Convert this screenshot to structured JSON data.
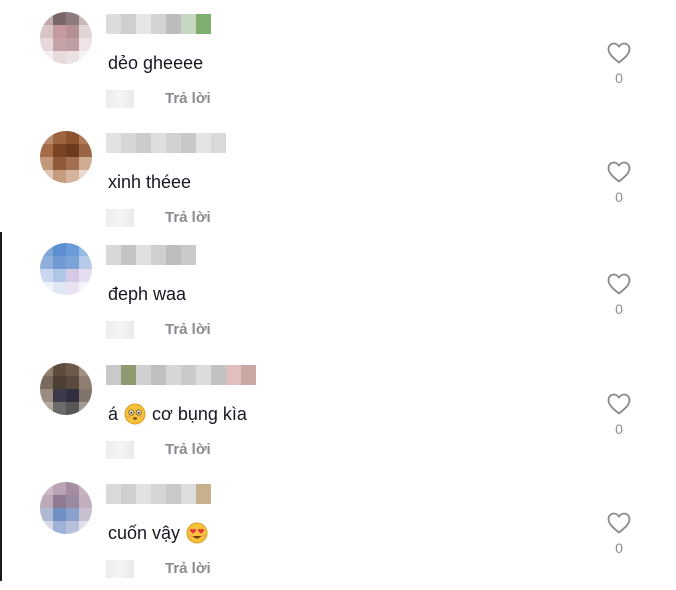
{
  "comments": [
    {
      "text": "dẻo gheeee",
      "reply_label": "Trả lời",
      "likes": "0",
      "avatar_colors": [
        "#bfa9a9",
        "#7a6869",
        "#8d7a7d",
        "#c9b9bb",
        "#d9c5c7",
        "#c79aa0",
        "#b48f94",
        "#e0d4d6",
        "#e7d9db",
        "#c4a2a6",
        "#bea0a4",
        "#eee4e6",
        "#f5f0f1",
        "#e6dadb",
        "#ece2e3",
        "#f6f2f3"
      ],
      "username_colors": [
        "#dcdcdc",
        "#cfcfcf",
        "#e6e6e6",
        "#d4d4d4",
        "#bcbcbc",
        "#c6d9c0",
        "#7fae6f"
      ]
    },
    {
      "text": "xinh théee",
      "reply_label": "Trả lời",
      "likes": "0",
      "avatar_colors": [
        "#b98a6a",
        "#9c6440",
        "#8b5230",
        "#b07a58",
        "#a56b47",
        "#7a4424",
        "#6e3a1d",
        "#9b6443",
        "#c3977a",
        "#8f5a38",
        "#a2704f",
        "#d0ab93",
        "#e0c7b6",
        "#c69c80",
        "#d5b39c",
        "#ead9cd"
      ],
      "username_colors": [
        "#e2e2e2",
        "#d6d6d6",
        "#cccccc",
        "#dedede",
        "#d2d2d2",
        "#c8c8c8",
        "#e4e4e4",
        "#d9d9d9"
      ]
    },
    {
      "text": "đeph waa",
      "reply_label": "Trả lời",
      "likes": "0",
      "avatar_colors": [
        "#7fa7d6",
        "#5c8fcf",
        "#6a9bd8",
        "#98bbe3",
        "#8fb0dc",
        "#6f9ad2",
        "#7aa3d8",
        "#b5cbe9",
        "#c9d8ef",
        "#b0c6e6",
        "#d6c9e6",
        "#e6ddef",
        "#eef2fa",
        "#dfe7f4",
        "#e9e3f1",
        "#f5f4fa"
      ],
      "username_colors": [
        "#d8d8d8",
        "#c4c4c4",
        "#e0e0e0",
        "#cfcfcf",
        "#bdbdbd",
        "#c9c9c9"
      ]
    },
    {
      "text_before": "á",
      "text_after": "cơ bụng kìa",
      "reply_label": "Trả lời",
      "likes": "0",
      "avatar_colors": [
        "#8d7d6e",
        "#5d4c3e",
        "#6b5a4b",
        "#a09080",
        "#7a6a5c",
        "#4e3f33",
        "#584a3e",
        "#8e7f70",
        "#9a8c7f",
        "#3c3a4a",
        "#2f2f3f",
        "#7f7569",
        "#b3aaa0",
        "#6c6a6a",
        "#5a5656",
        "#a29d97"
      ],
      "username_colors": [
        "#c9c9c9",
        "#8f9a70",
        "#d0d0d0",
        "#bfbfbf",
        "#d6d6d6",
        "#cacaca",
        "#dcdcdc",
        "#c2c2c2",
        "#e0c0bc",
        "#caa7a3"
      ]
    },
    {
      "text": "cuốn vậy",
      "reply_label": "Trả lời",
      "likes": "0",
      "avatar_colors": [
        "#cbb8c4",
        "#b9a3b4",
        "#a58ea2",
        "#c6b4c0",
        "#bda8b8",
        "#8f7a92",
        "#9a87a0",
        "#c0afbd",
        "#aeb9d4",
        "#6f8fc2",
        "#8aa2cb",
        "#c9c0cf",
        "#d7d8e6",
        "#9fb3d8",
        "#b7c1dc",
        "#e2e0ea"
      ],
      "username_colors": [
        "#dadada",
        "#cfcfcf",
        "#e2e2e2",
        "#d5d5d5",
        "#c9c9c9",
        "#dedede",
        "#c8b08c"
      ]
    }
  ]
}
